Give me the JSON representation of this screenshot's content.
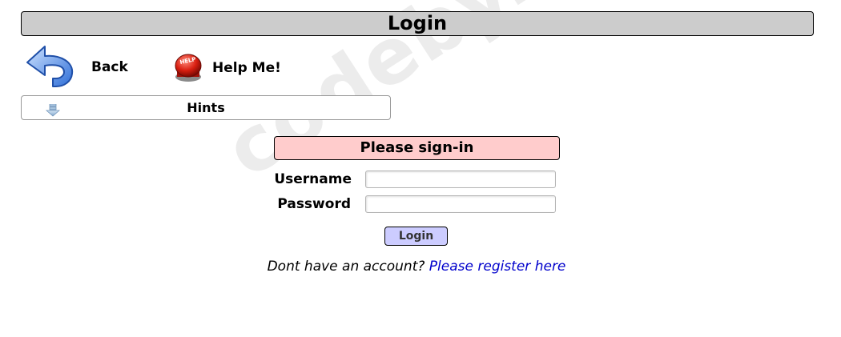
{
  "header": {
    "title": "Login"
  },
  "nav": {
    "back_label": "Back",
    "help_label": "Help Me!",
    "help_icon_text": "HELP"
  },
  "hints": {
    "label": "Hints"
  },
  "form": {
    "heading": "Please sign-in",
    "username_label": "Username",
    "username_value": "",
    "password_label": "Password",
    "password_value": "",
    "login_label": "Login"
  },
  "register": {
    "prompt": "Dont have an account?",
    "link_label": "Please register here"
  },
  "watermark": {
    "text": "codeby.net"
  },
  "colors": {
    "title_bg": "#cccccc",
    "signin_bg": "#ffcccc",
    "button_bg": "#ccccff",
    "link": "#0000cc"
  }
}
